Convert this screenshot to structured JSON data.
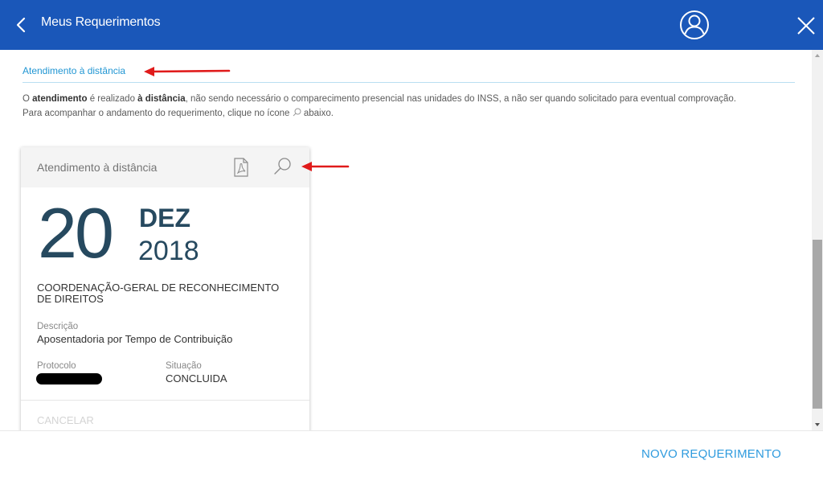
{
  "header": {
    "title": "Meus Requerimentos",
    "back_icon": "chevron-left-icon",
    "user_icon": "user-circle-icon",
    "close_icon": "close-icon",
    "background": "#1a57b9"
  },
  "section": {
    "title": "Atendimento à distância",
    "description": {
      "p1_before": "O ",
      "p1_bold1": "atendimento",
      "p1_mid": " é realizado ",
      "p1_bold2": "à distância",
      "p1_after": ", não sendo necessário o comparecimento presencial nas unidades do INSS, a não ser quando solicitado para eventual comprovação.",
      "p2_before": "Para acompanhar o andamento do requerimento, clique no ícone",
      "p2_after": "abaixo."
    }
  },
  "card": {
    "header_title": "Atendimento à distância",
    "pdf_icon": "pdf-icon",
    "search_icon": "search-icon",
    "day": "20",
    "month": "DEZ",
    "year": "2018",
    "organization": "COORDENAÇÃO-GERAL DE RECONHECIMENTO DE DIREITOS",
    "descricao_label": "Descrição",
    "descricao_value": "Aposentadoria por Tempo de Contribuição",
    "protocolo_label": "Protocolo",
    "situacao_label": "Situação",
    "situacao_value": "CONCLUIDA",
    "cancel_label": "CANCELAR"
  },
  "footer": {
    "new_request_label": "NOVO REQUERIMENTO",
    "accent": "#2f9bde"
  },
  "annotations": {
    "arrow_color": "#e01b1b"
  }
}
